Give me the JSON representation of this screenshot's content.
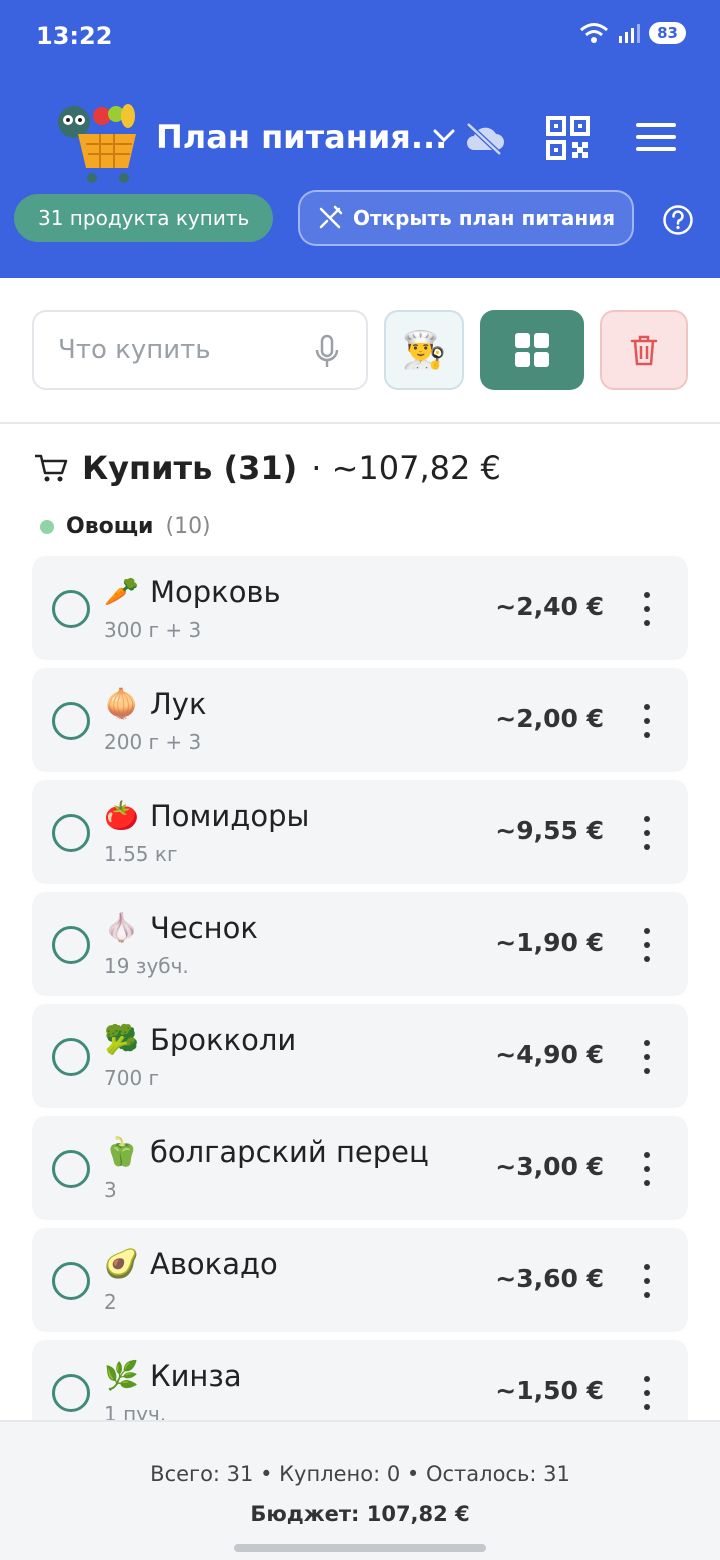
{
  "status_bar": {
    "time": "13:22",
    "battery": "83"
  },
  "app": {
    "title": "План питания..."
  },
  "chips": {
    "to_buy": "31 продукта купить",
    "open_plan": "Открыть план питания"
  },
  "search": {
    "placeholder": "Что купить"
  },
  "list": {
    "title": "Купить (31)",
    "total": "· ~107,82 €",
    "section": {
      "name": "Овощи",
      "count": "(10)"
    },
    "items": [
      {
        "emoji": "🥕",
        "name": "Морковь",
        "qty": "300 г + 3",
        "price": "~2,40 €"
      },
      {
        "emoji": "🧅",
        "name": "Лук",
        "qty": "200 г + 3",
        "price": "~2,00 €"
      },
      {
        "emoji": "🍅",
        "name": "Помидоры",
        "qty": "1.55 кг",
        "price": "~9,55 €"
      },
      {
        "emoji": "🧄",
        "name": "Чеснок",
        "qty": "19 зубч.",
        "price": "~1,90 €"
      },
      {
        "emoji": "🥦",
        "name": "Брокколи",
        "qty": "700 г",
        "price": "~4,90 €"
      },
      {
        "emoji": "🫑",
        "name": "болгарский перец",
        "qty": "3",
        "price": "~3,00 €"
      },
      {
        "emoji": "🥑",
        "name": "Авокадо",
        "qty": "2",
        "price": "~3,60 €"
      },
      {
        "emoji": "🌿",
        "name": "Кинза",
        "qty": "1 пуч.",
        "price": "~1,50 €"
      }
    ]
  },
  "footer": {
    "stats": "Всего: 31 • Куплено: 0 • Осталось: 31",
    "budget": "Бюджет: 107,82 €"
  },
  "colors": {
    "header": "#3b63e0",
    "accent_green": "#4a8c7a",
    "chip_green": "#4f9f8a",
    "danger": "#e05555"
  },
  "icons": {
    "search_mic": "microphone-icon",
    "chef": "chef-icon",
    "grid": "grid-icon",
    "trash": "trash-icon",
    "menu": "hamburger-menu-icon",
    "qr": "qr-code-icon",
    "cloud": "cloud-off-icon",
    "help": "help-icon",
    "cart": "cart-icon",
    "plan": "fork-knife-icon"
  }
}
